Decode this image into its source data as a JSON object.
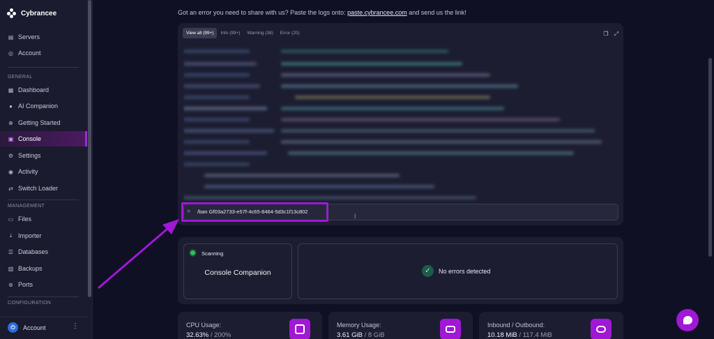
{
  "sidebar": {
    "brand": "Cybrancee",
    "top_items": [
      {
        "label": "Servers",
        "icon": "server-icon"
      },
      {
        "label": "Account",
        "icon": "user-icon"
      }
    ],
    "sections": {
      "general": "GENERAL",
      "management": "MANAGEMENT",
      "configuration": "CONFIGURATION"
    },
    "general_items": [
      {
        "label": "Dashboard",
        "icon": "grid-icon"
      },
      {
        "label": "AI Companion",
        "icon": "chat-icon"
      },
      {
        "label": "Getting Started",
        "icon": "globe-icon"
      },
      {
        "label": "Console",
        "icon": "terminal-icon",
        "active": true
      },
      {
        "label": "Settings",
        "icon": "gear-icon"
      },
      {
        "label": "Activity",
        "icon": "eye-icon"
      },
      {
        "label": "Switch Loader",
        "icon": "switch-icon"
      }
    ],
    "management_items": [
      {
        "label": "Files",
        "icon": "folder-icon"
      },
      {
        "label": "Importer",
        "icon": "download-icon"
      },
      {
        "label": "Databases",
        "icon": "database-icon"
      },
      {
        "label": "Backups",
        "icon": "archive-icon"
      },
      {
        "label": "Ports",
        "icon": "network-icon"
      }
    ],
    "footer": {
      "label": "Account",
      "avatar_letter": "⏻"
    }
  },
  "notice": {
    "prefix": "Got an error you need to share with us? Paste the logs onto: ",
    "link": "paste.cybrancee.com",
    "suffix": " and send us the link!"
  },
  "console": {
    "tabs": [
      "View all (99+)",
      "Info (99+)",
      "Warning (38)",
      "Error (20)"
    ],
    "command": "/ban Gf03a2733-e57f-4c65-8464-5d3c1f13c802"
  },
  "companion": {
    "status": "Scanning",
    "title": "Console Companion",
    "result": "No errors detected"
  },
  "stats": [
    {
      "label": "CPU Usage:",
      "value": "32.63%",
      "sub": " / 200%",
      "icon": "cpu-icon"
    },
    {
      "label": "Memory Usage:",
      "value": "3.61 GiB",
      "sub": " / 8 GiB",
      "icon": "memory-icon"
    },
    {
      "label": "Inbound / Outbound:",
      "value": "10.18 MiB",
      "sub": " / 117.4 MiB",
      "icon": "cloud-icon"
    }
  ],
  "colors": {
    "accent": "#a117d6",
    "background": "#0f1024",
    "sidebar": "#1a1b2e",
    "card": "#1c1d31",
    "success": "#2fbf57"
  }
}
